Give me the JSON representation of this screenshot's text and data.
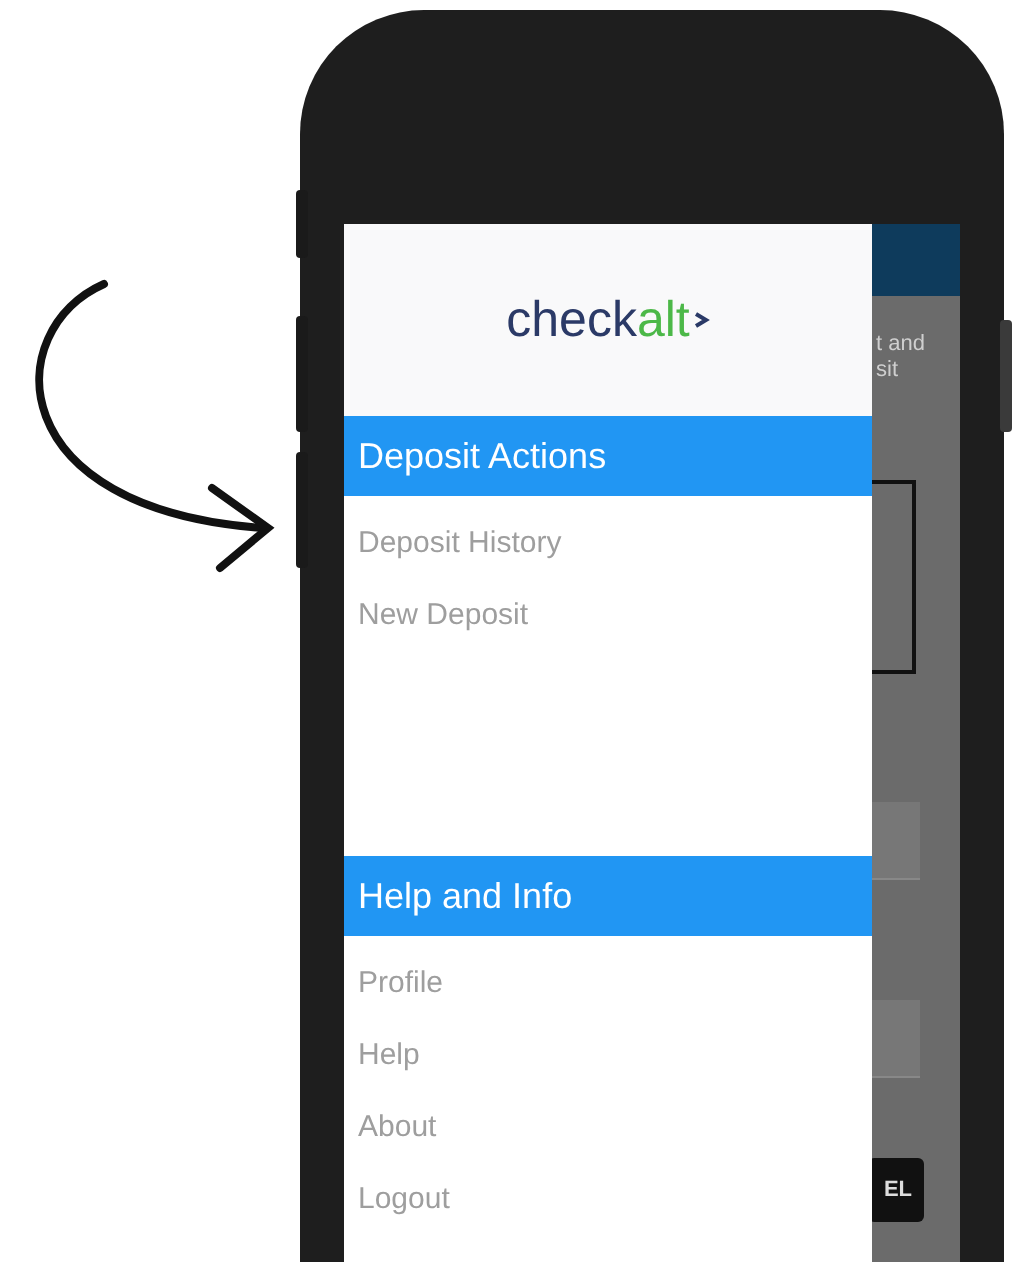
{
  "drawer": {
    "logo": {
      "dark_part": "check",
      "green_part": "alt"
    },
    "sections": [
      {
        "title": "Deposit Actions",
        "items": [
          "Deposit History",
          "New Deposit"
        ]
      },
      {
        "title": "Help and Info",
        "items": [
          "Profile",
          "Help",
          "About",
          "Logout"
        ]
      }
    ]
  },
  "background_screen": {
    "text_1": "t and",
    "text_2": "sit",
    "button": "EL"
  }
}
